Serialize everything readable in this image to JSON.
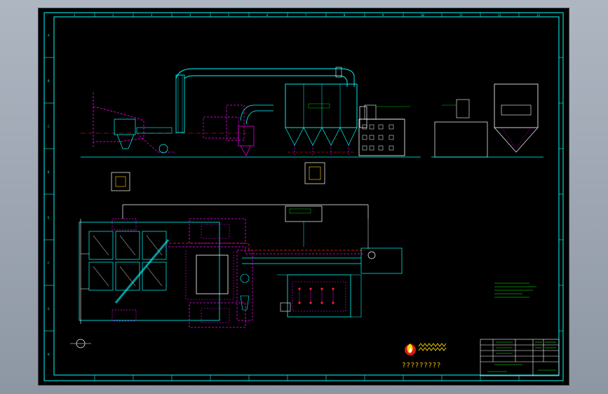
{
  "drawing": {
    "background": "#000000",
    "frame_color": "#00ffff",
    "grid_numbers_top": [
      "1",
      "2",
      "3",
      "4",
      "5",
      "6",
      "7",
      "8",
      "9",
      "10",
      "11",
      "12",
      "13"
    ],
    "grid_letters_side": [
      "A",
      "B",
      "C",
      "D",
      "E",
      "F",
      "G",
      "H"
    ],
    "logo_caption": "?????????",
    "colors": {
      "cyan": "#00ffff",
      "magenta": "#ff00ff",
      "red": "#ff2020",
      "green": "#00ff00",
      "white": "#ffffff",
      "yellow": "#ffd800"
    }
  }
}
